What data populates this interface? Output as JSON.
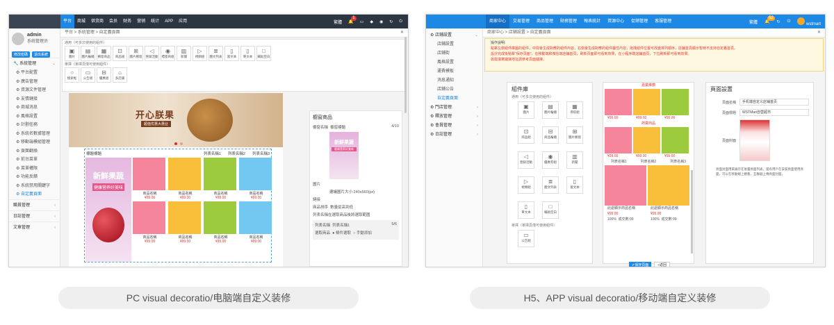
{
  "pc": {
    "topnav": [
      "平台",
      "商城",
      "供货商",
      "会员",
      "财务",
      "营销",
      "统计",
      "APP",
      "应用"
    ],
    "topnav_right": {
      "user_label": "繁體",
      "badge": "1"
    },
    "user": {
      "name": "admin",
      "role": "系统管理员",
      "btn_pwd": "修改密碼",
      "btn_logout": "退出系統"
    },
    "sidebar_group": "系統管理",
    "sidebar_items": [
      "平台配置",
      "廣告管理",
      "資源文件管理",
      "友情鏈接",
      "商城消息",
      "風格設置",
      "計劃任務",
      "系統名數據管理",
      "移動端模組管理",
      "頁面翻換",
      "前台菜單",
      "菜單權限",
      "功能反饋",
      "系統禁用關鍵字",
      "自定義頁面"
    ],
    "sidebar_bottom": [
      "職員管理",
      "日誌管理",
      "文章管理"
    ],
    "breadcrumb": "平台 > 系統管理 > 自定義頁面",
    "widget_label_1": "通用（可多次使用的組件）",
    "widget_label_2": "單擇（單擇頁僅可使用組件）",
    "widgets_row1": [
      "圖片",
      "圖片輪播",
      "櫥窗商品",
      "商品組",
      "圖片櫥窗",
      "營銷活動",
      "標簽商組",
      "新聞",
      "視頻組",
      "圖文列表",
      "富文本",
      "單文本",
      "輔助空白"
    ],
    "widgets_row2": [
      "搜索框",
      "公告組",
      "優惠組",
      "多店鋪"
    ],
    "banner": {
      "title": "开心朕果",
      "sub": "超值优惠大惠业"
    },
    "products": {
      "header_left": "標題標題",
      "tabs": [
        "列表名稱1",
        "列表名稱2",
        "列表名稱3"
      ],
      "big_t1": "新鲜果蔬",
      "big_t2": "健康营养好美味",
      "name": "商品名稱",
      "price": "¥99.00",
      "colors": [
        "#f4859a",
        "#f9bf3b",
        "#9ccc3d",
        "#73c8f2"
      ]
    },
    "props": {
      "title": "櫥窗商品",
      "name_label": "櫥窗名稱",
      "name_val": "櫥窗標題",
      "count": "4/10",
      "pic_t1": "新鲜果蔬",
      "pic_t2": "健康营养好美味",
      "pic_label": "圖片",
      "pic_hint": "建議圖片大小:240x560(px)",
      "link_label": "鏈接",
      "sort_label": "商品排序",
      "sort_val": "數量從高到低",
      "list_hint": "列表名稱在選取商品後將選取範圍",
      "list_name_label": "列表名稱",
      "list_name_val": "列表名稱1",
      "list_count": "5/6",
      "choose_label": "選取商品",
      "opt1": "條件選取",
      "opt2": "手動添加"
    }
  },
  "h5": {
    "topnav": [
      "商家中心",
      "交易管理",
      "商品管理",
      "財務管理",
      "報表統計",
      "資源中心",
      "促銷管理",
      "客服管理"
    ],
    "topnav_right": {
      "lang": "繁體",
      "badge": "52",
      "user": "wstmart"
    },
    "sidebar_group": "店鋪設置",
    "sidebar_items": [
      "店鋪設置",
      "店鋪街",
      "風格設置",
      "運費模板",
      "消息通知",
      "店鋪公告",
      "自定義頁面"
    ],
    "sidebar_bottom": [
      "門店管理",
      "釋放管理",
      "會員管理",
      "日誌管理"
    ],
    "breadcrumb": "商家中心 > 店鋪設置 > 自定義頁面",
    "notice": {
      "title": "操作說明:",
      "l1": "點擊左側組件庫圖的組件，中間會生成對應的組件內容，右側會生成對應的組件屬性內容，拖拽組件位置可改變排列順序，店鋪首頁顯示暫時不支持自定義首頁。",
      "l2": "設計完成後點擊\"保存頁面\"，在移動端和微信端店鋪首頁，刷新頁面即可看到效果，在小程序端店鋪首頁，下拉刷新即可看到效果。",
      "l3": "如需填寫鏈接地址請參考頁面鏈接。"
    },
    "lib": {
      "title": "組件庫",
      "sub1": "通用（可多次使用的組件）",
      "widgets": [
        "圖片",
        "圖片輪播",
        "導航組",
        "商品組",
        "商品輪播",
        "圖片櫥窗",
        "營銷活動",
        "優惠券組",
        "新聞",
        "視頻組",
        "圖文列表",
        "富文本",
        "單文本",
        "輔助空白"
      ],
      "sub2": "單擇（單擇頁僅可使用組件）",
      "single": [
        "公告組"
      ]
    },
    "phone": {
      "hdr1": "嘉業推薦",
      "hdr2": "熱賣商品",
      "price": "¥99.00",
      "tabs": [
        "列表名稱1",
        "列表名稱2",
        "列表名稱3"
      ],
      "cap1": "此處顯示商品名稱",
      "cap2": "此處顯示商品名稱",
      "pct": "100%",
      "sold": "成交數:99",
      "colors": [
        "#f4859a",
        "#f9bf3b",
        "#9ccc3d"
      ]
    },
    "pset": {
      "title": "頁面設置",
      "k1": "頁面名稱",
      "v1": "手机端自定义店铺首页",
      "k2": "頁面標題",
      "v2": "WSTMart自营超市",
      "k3": "頁面封面",
      "desc": "頁面封面用來展示在後臺頁面列表，當有用戶在安裝頁面使用頁面，可以在移動端上觀看，互聯器上傳頁面封面。"
    },
    "save": "保存頁面",
    "back": "返回"
  },
  "captions": {
    "pc": "PC visual decoratio/电脑端自定义装修",
    "h5": "H5、APP  visual decoratio/移动端自定义装修"
  }
}
